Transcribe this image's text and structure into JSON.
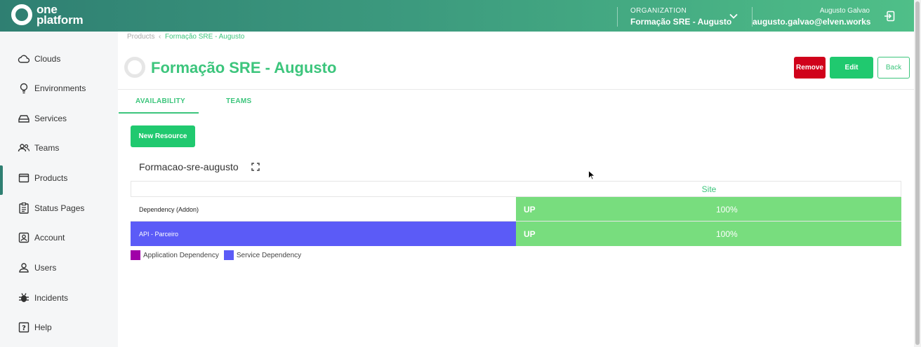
{
  "header": {
    "logo_line1": "one",
    "logo_line2": "platform",
    "org_label": "ORGANIZATION",
    "org_name": "Formação SRE - Augusto",
    "user_name": "Augusto Galvao",
    "user_email": "augusto.galvao@elven.works"
  },
  "sidebar": {
    "items": [
      {
        "label": "Clouds",
        "icon": "cloud-icon"
      },
      {
        "label": "Environments",
        "icon": "lightbulb-icon"
      },
      {
        "label": "Services",
        "icon": "server-icon"
      },
      {
        "label": "Teams",
        "icon": "people-icon"
      },
      {
        "label": "Products",
        "icon": "window-icon",
        "active": true
      },
      {
        "label": "Status Pages",
        "icon": "clipboard-icon"
      },
      {
        "label": "Account",
        "icon": "account-box-icon"
      },
      {
        "label": "Users",
        "icon": "person-icon"
      },
      {
        "label": "Incidents",
        "icon": "bug-icon"
      },
      {
        "label": "Help",
        "icon": "help-icon"
      }
    ]
  },
  "breadcrumb": {
    "root": "Products",
    "separator": "‹",
    "current": "Formação SRE - Augusto"
  },
  "page": {
    "title": "Formação SRE - Augusto",
    "remove_label": "Remove",
    "edit_label": "Edit",
    "back_label": "Back"
  },
  "tabs": [
    {
      "label": "AVAILABILITY",
      "active": true
    },
    {
      "label": "TEAMS",
      "active": false
    }
  ],
  "new_resource_label": "New Resource",
  "section_title": "Formacao-sre-augusto",
  "table": {
    "column_header": "Site",
    "rows": [
      {
        "name": "Dependency (Addon)",
        "status": "UP",
        "percent": "100%",
        "type": "none"
      },
      {
        "name": "API - Parceiro",
        "status": "UP",
        "percent": "100%",
        "type": "service"
      }
    ]
  },
  "legend": [
    {
      "label": "Application Dependency",
      "color": "#a000a8"
    },
    {
      "label": "Service Dependency",
      "color": "#5b5bf7"
    }
  ],
  "colors": {
    "brand_green": "#3cc57c",
    "button_green": "#20c96f",
    "remove_red": "#d0021b",
    "status_up": "#78dd7e",
    "service_dependency": "#5b5bf7",
    "application_dependency": "#a000a8"
  }
}
